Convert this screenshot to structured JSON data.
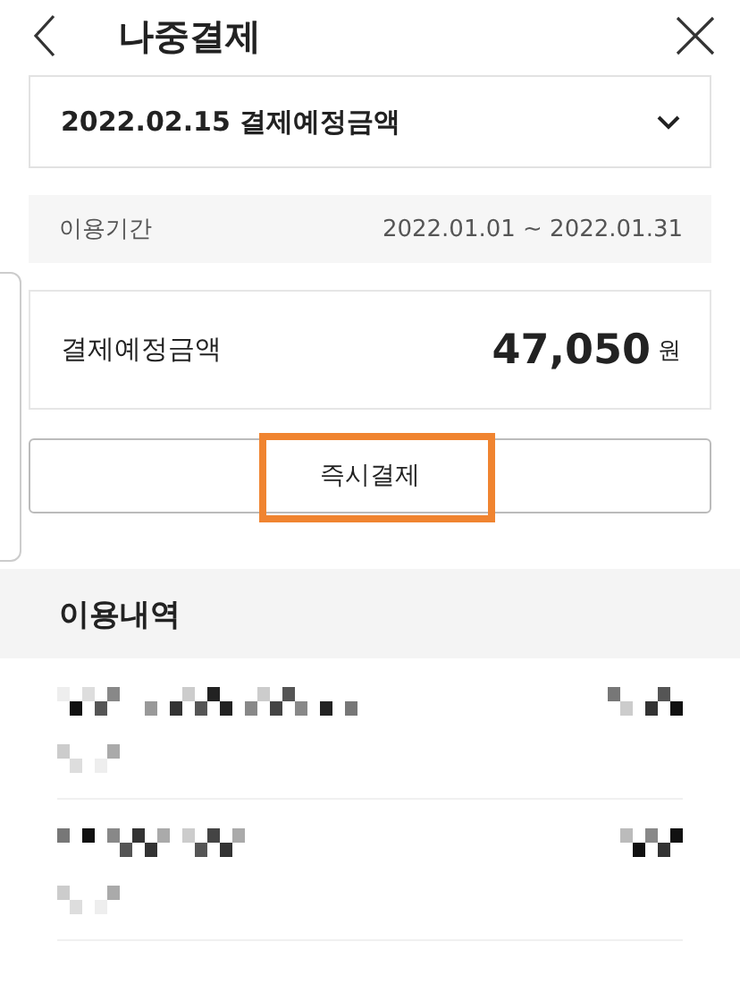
{
  "header": {
    "title": "나중결제"
  },
  "statement_select": {
    "value": "2022.02.15 결제예정금액"
  },
  "period": {
    "label": "이용기간",
    "value": "2022.01.01 ~ 2022.01.31"
  },
  "amount": {
    "label": "결제예정금액",
    "value": "47,050",
    "unit": "원"
  },
  "pay_button": {
    "label": "즉시결제",
    "highlighted": true
  },
  "usage_section": {
    "title": "이용내역"
  }
}
